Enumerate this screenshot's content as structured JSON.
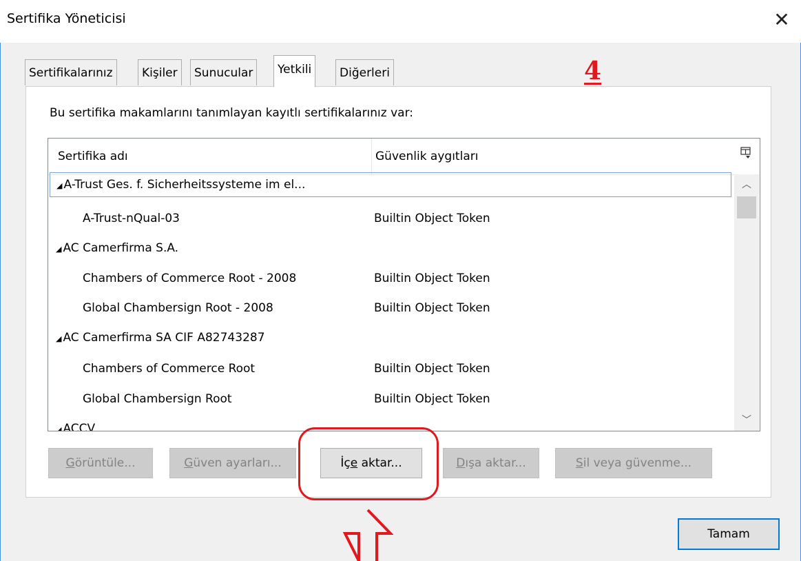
{
  "window": {
    "title": "Sertifika Yöneticisi",
    "close_glyph": "✕"
  },
  "tabs": [
    {
      "label": "Sertifikalarınız",
      "active": false
    },
    {
      "label": "Kişiler",
      "active": false
    },
    {
      "label": "Sunucular",
      "active": false
    },
    {
      "label": "Yetkili",
      "active": true
    },
    {
      "label": "Diğerleri",
      "active": false
    }
  ],
  "annotation": {
    "step_number": "4",
    "color": "#e0191e"
  },
  "description": "Bu sertifika makamlarını tanımlayan kayıtlı sertifikalarınız var:",
  "tree": {
    "columns": [
      "Sertifika adı",
      "Güvenlik aygıtları"
    ],
    "column_picker_icon": "column-picker-icon",
    "rows": [
      {
        "type": "group",
        "name": "A-Trust Ges. f. Sicherheitssysteme im el...",
        "device": ""
      },
      {
        "type": "child",
        "name": "A-Trust-nQual-03",
        "device": "Builtin Object Token"
      },
      {
        "type": "group",
        "name": "AC Camerfirma S.A.",
        "device": ""
      },
      {
        "type": "child",
        "name": "Chambers of Commerce Root - 2008",
        "device": "Builtin Object Token"
      },
      {
        "type": "child",
        "name": "Global Chambersign Root - 2008",
        "device": "Builtin Object Token"
      },
      {
        "type": "group",
        "name": "AC Camerfirma SA CIF A82743287",
        "device": ""
      },
      {
        "type": "child",
        "name": "Chambers of Commerce Root",
        "device": "Builtin Object Token"
      },
      {
        "type": "child",
        "name": "Global Chambersign Root",
        "device": "Builtin Object Token"
      },
      {
        "type": "group",
        "name": "ACCV",
        "device": ""
      }
    ]
  },
  "buttons": {
    "view": {
      "before": "",
      "key": "G",
      "after": "örüntüle..."
    },
    "trust": {
      "before": "",
      "key": "G",
      "after": "üven ayarları..."
    },
    "import": {
      "before": "İç",
      "key": "e",
      "after": " aktar..."
    },
    "export": {
      "before": "",
      "key": "D",
      "after": "ışa aktar..."
    },
    "delete": {
      "before": "",
      "key": "S",
      "after": "il veya güvenme..."
    },
    "ok": "Tamam"
  }
}
